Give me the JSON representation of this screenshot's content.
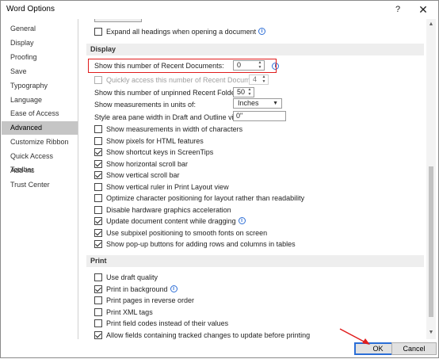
{
  "window": {
    "title": "Word Options",
    "help": "?",
    "close": "✕"
  },
  "sidebar": {
    "items": [
      {
        "label": "General",
        "active": false
      },
      {
        "label": "Display",
        "active": false
      },
      {
        "label": "Proofing",
        "active": false
      },
      {
        "label": "Save",
        "active": false
      },
      {
        "label": "Typography",
        "active": false
      },
      {
        "label": "Language",
        "active": false
      },
      {
        "label": "Ease of Access",
        "active": false
      },
      {
        "label": "Advanced",
        "active": true
      },
      {
        "label": "Customize Ribbon",
        "active": false
      },
      {
        "label": "Quick Access Toolbar",
        "active": false
      },
      {
        "label": "Add-ins",
        "active": false
      },
      {
        "label": "Trust Center",
        "active": false
      }
    ]
  },
  "top": {
    "expand_headings": "Expand all headings when opening a document"
  },
  "display": {
    "heading": "Display",
    "recent_docs_label": "Show this number of Recent Documents:",
    "recent_docs_value": "0",
    "quick_access_label": "Quickly access this number of Recent Documents:",
    "quick_access_value": "4",
    "unpinned_label": "Show this number of unpinned Recent Folders:",
    "unpinned_value": "50",
    "units_label": "Show measurements in units of:",
    "units_value": "Inches",
    "style_pane_label": "Style area pane width in Draft and Outline views:",
    "style_pane_value": "0\"",
    "checkboxes": [
      {
        "label": "Show measurements in width of characters",
        "checked": false
      },
      {
        "label": "Show pixels for HTML features",
        "checked": false
      },
      {
        "label": "Show shortcut keys in ScreenTips",
        "checked": true
      },
      {
        "label": "Show horizontal scroll bar",
        "checked": true
      },
      {
        "label": "Show vertical scroll bar",
        "checked": true
      },
      {
        "label": "Show vertical ruler in Print Layout view",
        "checked": false
      },
      {
        "label": "Optimize character positioning for layout rather than readability",
        "checked": false
      },
      {
        "label": "Disable hardware graphics acceleration",
        "checked": false
      },
      {
        "label": "Update document content while dragging",
        "checked": true,
        "info": true
      },
      {
        "label": "Use subpixel positioning to smooth fonts on screen",
        "checked": true
      },
      {
        "label": "Show pop-up buttons for adding rows and columns in tables",
        "checked": true
      }
    ]
  },
  "print": {
    "heading": "Print",
    "checkboxes": [
      {
        "label": "Use draft quality",
        "checked": false
      },
      {
        "label": "Print in background",
        "checked": true,
        "info": true
      },
      {
        "label": "Print pages in reverse order",
        "checked": false
      },
      {
        "label": "Print XML tags",
        "checked": false
      },
      {
        "label": "Print field codes instead of their values",
        "checked": false
      },
      {
        "label": "Allow fields containing tracked changes to update before printing",
        "checked": true
      }
    ]
  },
  "buttons": {
    "ok": "OK",
    "cancel": "Cancel"
  },
  "colors": {
    "highlight": "#e01c1c",
    "accent": "#2b6ed6",
    "active_sidebar": "#c5c5c5"
  }
}
